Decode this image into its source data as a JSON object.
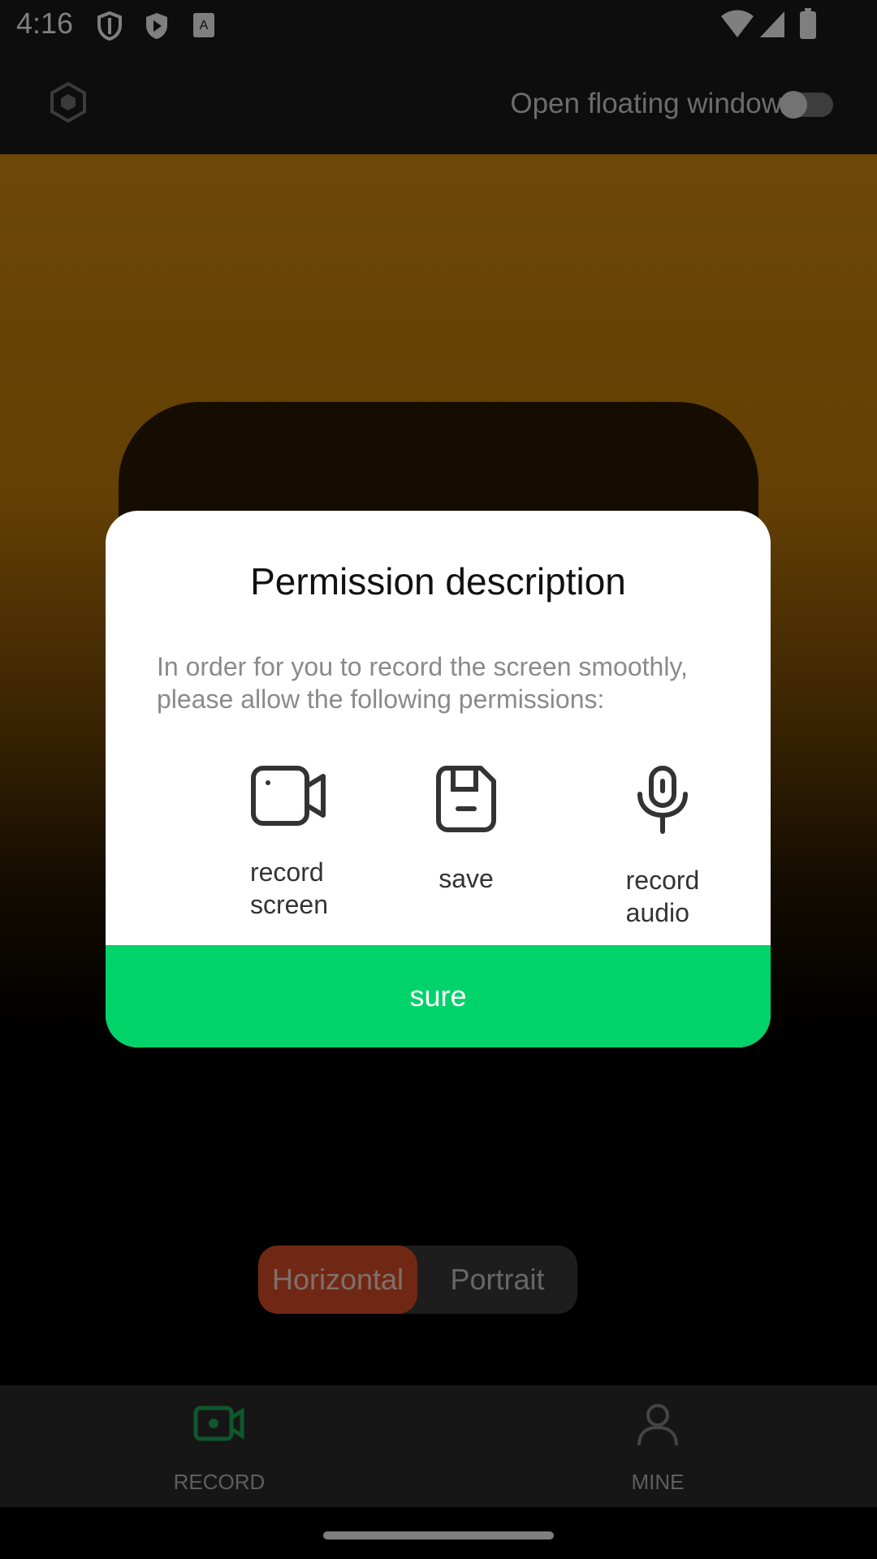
{
  "status_bar": {
    "time": "4:16",
    "icons": [
      "shield-icon",
      "play-store-icon",
      "keyboard-icon",
      "wifi-icon",
      "signal-icon",
      "battery-icon"
    ]
  },
  "header": {
    "settings_icon": "hexagon-settings-icon",
    "floating_window_label": "Open floating window",
    "floating_window_enabled": false
  },
  "orientation": {
    "options": [
      "Horizontal",
      "Portrait"
    ],
    "selected": "Horizontal"
  },
  "bottom_nav": {
    "tabs": [
      {
        "label": "RECORD",
        "icon": "video-camera-icon",
        "active": true
      },
      {
        "label": "MINE",
        "icon": "person-icon",
        "active": false
      }
    ]
  },
  "dialog": {
    "title": "Permission description",
    "description": "In order for you to record the screen smoothly, please allow the following permissions:",
    "permissions": [
      {
        "label_line1": "record",
        "label_line2": "screen",
        "icon": "video-camera-icon"
      },
      {
        "label_line1": "save",
        "label_line2": "",
        "icon": "save-icon"
      },
      {
        "label_line1": "record",
        "label_line2": "audio",
        "icon": "microphone-icon"
      }
    ],
    "confirm_label": "sure"
  },
  "colors": {
    "accent_green": "#00d36a",
    "orientation_selected": "#e0502a",
    "preview_gradient_top": "#d98f0e"
  }
}
